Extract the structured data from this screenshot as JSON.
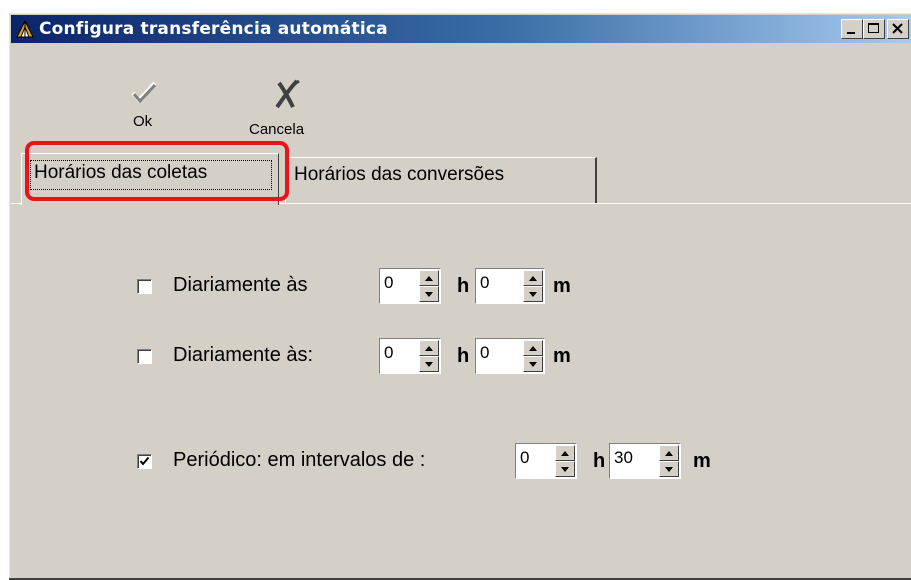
{
  "window": {
    "title": "Configura transferência automática",
    "app_icon": "triangle-compass-icon",
    "controls": [
      "minimize-icon",
      "maximize-icon",
      "close-icon"
    ]
  },
  "toolbar": {
    "ok_label": "Ok",
    "ok_icon": "checkmark-icon",
    "cancel_label": "Cancela",
    "cancel_icon": "cross-icon"
  },
  "tabs": [
    {
      "label": "Horários das coletas",
      "active": true
    },
    {
      "label": "Horários das conversões",
      "active": false
    }
  ],
  "schedule": {
    "daily1": {
      "label": "Diariamente às",
      "checked": false,
      "hours": "0",
      "minutes": "0"
    },
    "daily2": {
      "label": "Diariamente às:",
      "checked": false,
      "hours": "0",
      "minutes": "0"
    },
    "periodic": {
      "label": "Periódico: em intervalos de :",
      "checked": true,
      "hours": "0",
      "minutes": "30"
    },
    "hour_unit": "h",
    "minute_unit": "m"
  },
  "colors": {
    "highlight": "#e8141c",
    "title_start": "#0a246a",
    "title_end": "#a6caf0",
    "dialog_bg": "#d4d0c8"
  }
}
